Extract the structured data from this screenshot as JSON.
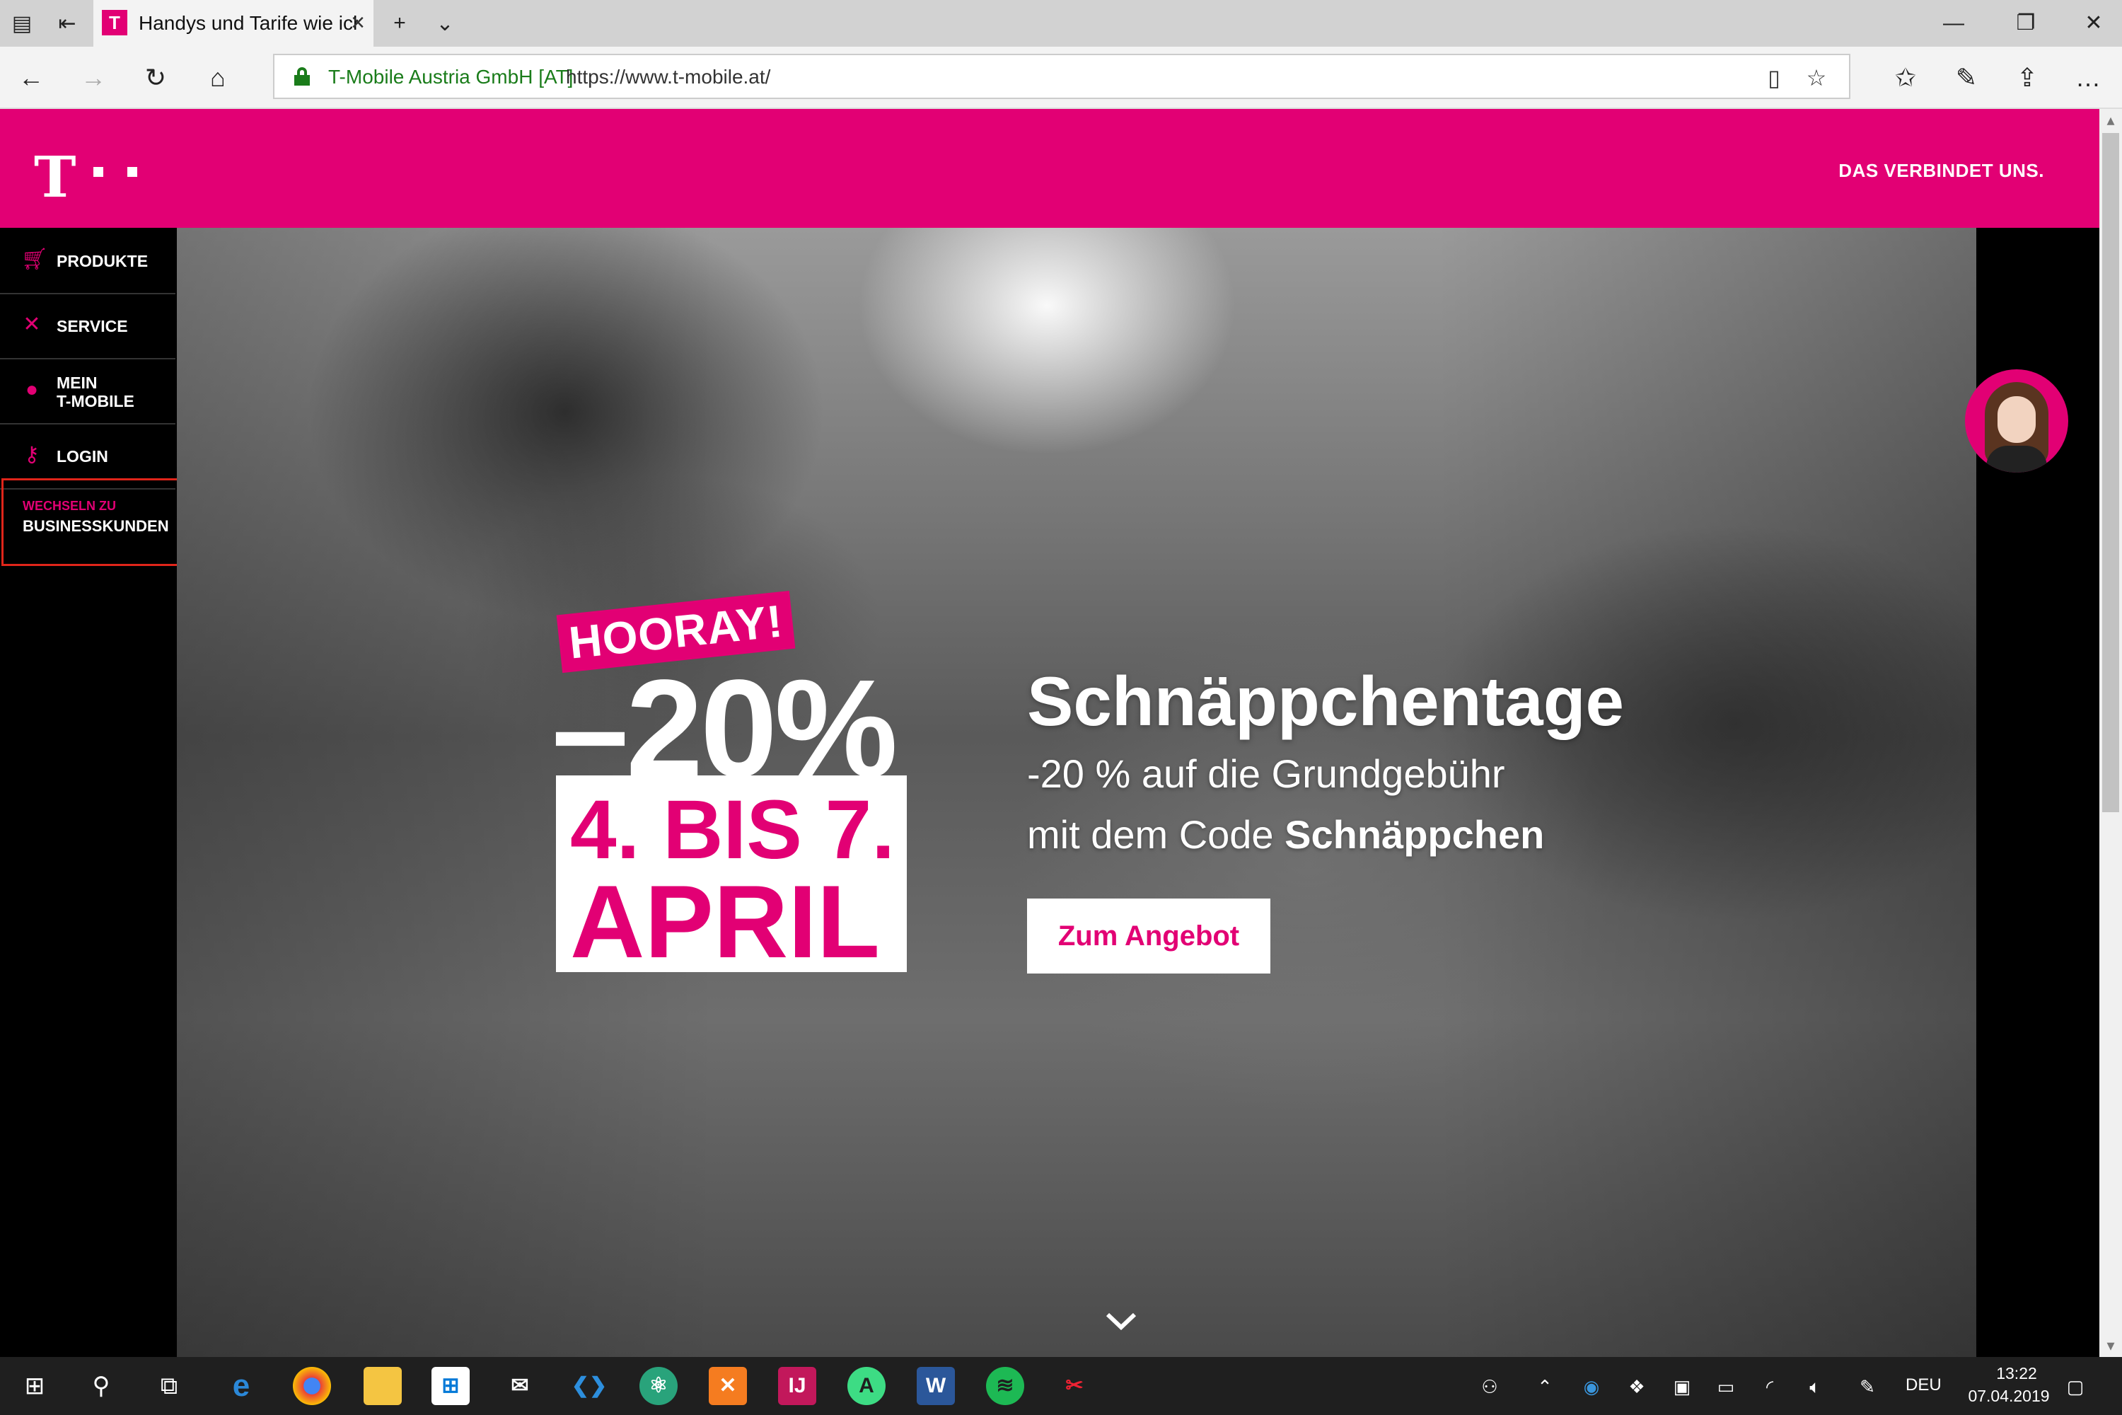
{
  "browser": {
    "tab_title": "Handys und Tarife wie ich",
    "url_company": "T-Mobile Austria GmbH [AT]",
    "url": "https://www.t-mobile.at/",
    "icons": [
      "tab-manager-icon",
      "set-aside-icon",
      "back-icon",
      "forward-icon",
      "refresh-icon",
      "home-icon",
      "reading-view-icon",
      "favorite-star-icon",
      "favorites-hub-icon",
      "pen-icon",
      "share-icon",
      "more-icon"
    ]
  },
  "header": {
    "logo_letter": "T",
    "slogan": "DAS VERBINDET UNS."
  },
  "sidebar": {
    "items": [
      {
        "label": "PRODUKTE",
        "icon": "cart-icon"
      },
      {
        "label": "SERVICE",
        "icon": "tools-icon"
      },
      {
        "label": "MEIN\nT-MOBILE",
        "line1": "MEIN",
        "line2": "T-MOBILE",
        "icon": "user-icon"
      },
      {
        "label": "LOGIN",
        "icon": "key-icon"
      }
    ],
    "business_small": "WECHSELN ZU",
    "business_big": "BUSINESSKUNDEN"
  },
  "hero": {
    "badge": "HOORAY!",
    "discount": "–20%",
    "date_line1": "4. BIS 7.",
    "date_line2": "APRIL",
    "headline": "Schnäppchentage",
    "subline1": "-20 % auf die Grundgebühr",
    "subline2_prefix": "mit dem Code ",
    "subline2_code": "Schnäppchen",
    "cta": "Zum Angebot"
  },
  "taskbar": {
    "language": "DEU",
    "time": "13:22",
    "date": "07.04.2019"
  },
  "colors": {
    "brand": "#e20074",
    "highlight_border": "#e0251a",
    "url_green": "#1a7c1a"
  }
}
